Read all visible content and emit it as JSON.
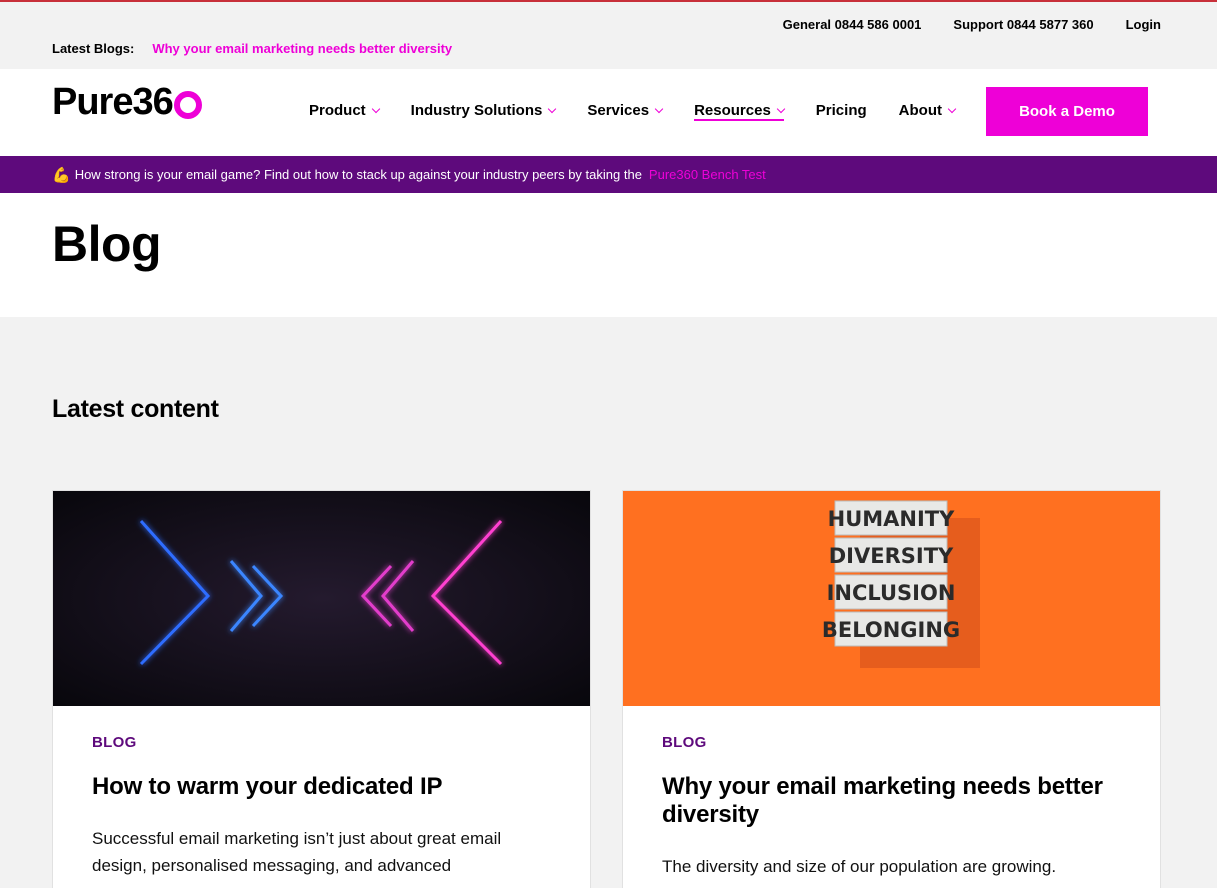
{
  "utility": {
    "general": "General 0844 586 0001",
    "support": "Support 0844 5877 360",
    "login": "Login",
    "latest_label": "Latest Blogs:",
    "latest_link": "Why your email marketing needs better diversity"
  },
  "nav": {
    "logo_text": "Pure36",
    "items": [
      {
        "label": "Product",
        "dropdown": true
      },
      {
        "label": "Industry Solutions",
        "dropdown": true
      },
      {
        "label": "Services",
        "dropdown": true
      },
      {
        "label": "Resources",
        "dropdown": true
      },
      {
        "label": "Pricing",
        "dropdown": false
      },
      {
        "label": "About",
        "dropdown": true
      }
    ],
    "cta": "Book a Demo"
  },
  "banner": {
    "emoji": "💪",
    "text": "How strong is your email game? Find out how to stack up against your industry peers by taking the",
    "link": "Pure360 Bench Test"
  },
  "hero": {
    "title": "Blog"
  },
  "section": {
    "title": "Latest content"
  },
  "cards": [
    {
      "category": "BLOG",
      "title": "How to warm your dedicated IP",
      "desc": "Successful email marketing isn’t just about great email design, personalised messaging, and advanced"
    },
    {
      "category": "BLOG",
      "title": "Why your email marketing needs better diversity",
      "desc": "The diversity and size of our population are growing.",
      "image_words": [
        "HUMANITY",
        "DIVERSITY",
        "INCLUSION",
        "BELONGING"
      ]
    }
  ],
  "colors": {
    "brand_pink": "#ee00d7",
    "brand_purple": "#5e0a7c"
  }
}
